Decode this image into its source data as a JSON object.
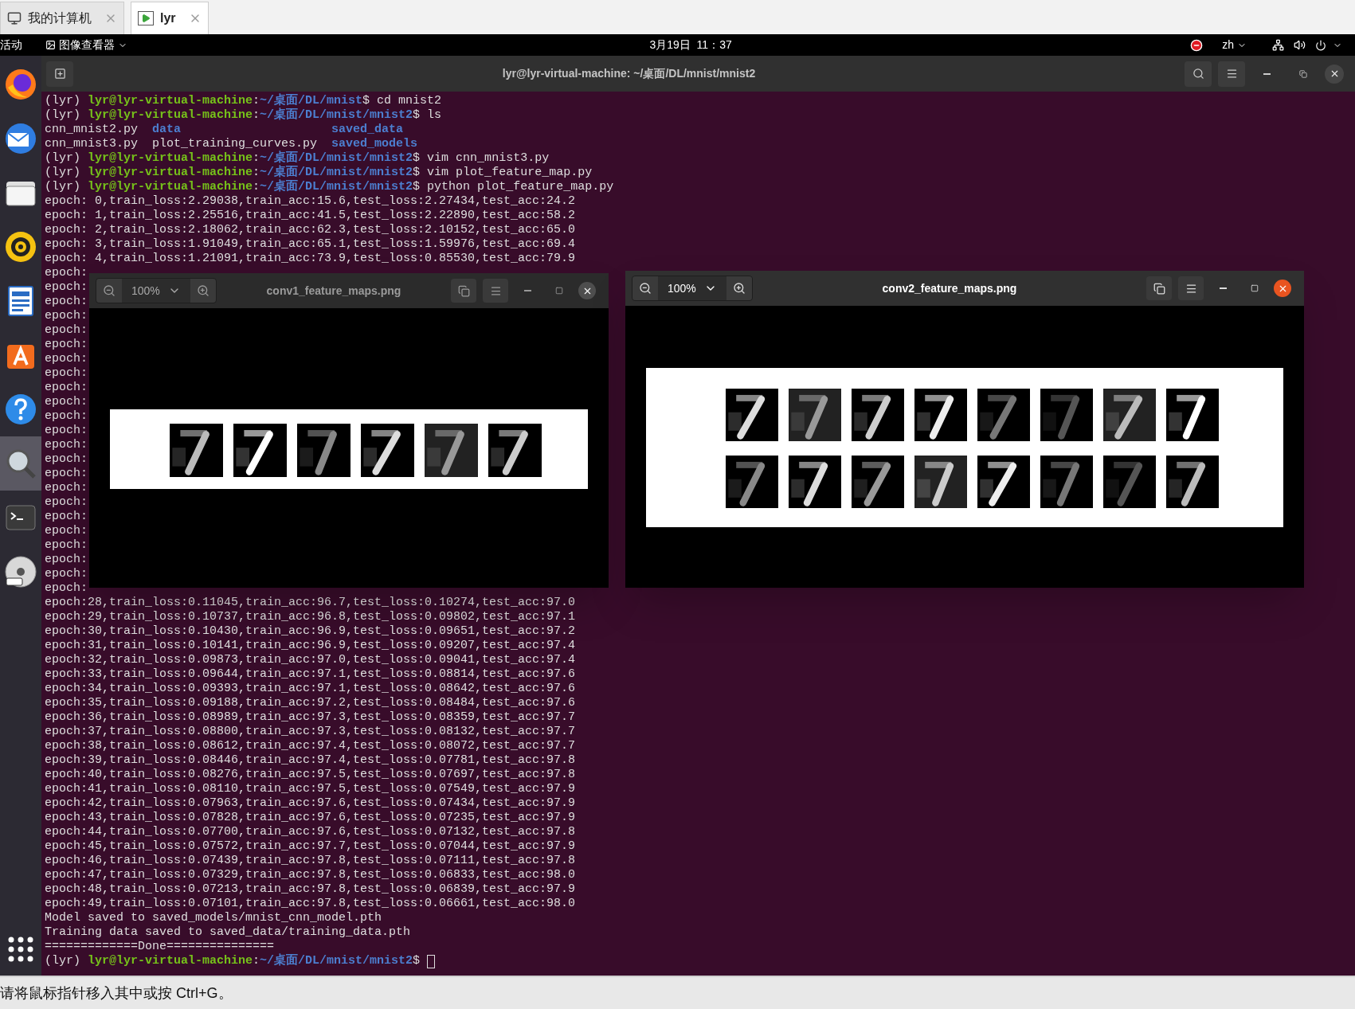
{
  "vm_tabs": [
    {
      "label": "我的计算机",
      "kind": "computer",
      "selected": false
    },
    {
      "label": "lyr",
      "kind": "vm",
      "selected": true
    }
  ],
  "top_bar": {
    "activities": "活动",
    "app_menu": "图像查看器",
    "clock": "3月19日  11：37",
    "input_method": "zh"
  },
  "dock": {
    "items": [
      {
        "kind": "browser",
        "selected": false
      },
      {
        "kind": "mail",
        "selected": false
      },
      {
        "kind": "files",
        "selected": false
      },
      {
        "kind": "music",
        "selected": false
      },
      {
        "kind": "document",
        "selected": false
      },
      {
        "kind": "software",
        "selected": false
      },
      {
        "kind": "help",
        "selected": false
      },
      {
        "kind": "viewer",
        "selected": true
      },
      {
        "kind": "terminal",
        "selected": false
      },
      {
        "kind": "disc",
        "selected": false
      }
    ]
  },
  "terminal": {
    "title": "lyr@lyr-virtual-machine: ~/桌面/DL/mnist/mnist2",
    "lines": [
      {
        "segments": [
          {
            "text": "(lyr) ",
            "kind": "plain"
          },
          {
            "text": "lyr@lyr-virtual-machine",
            "kind": "user"
          },
          {
            "text": ":",
            "kind": "plain"
          },
          {
            "text": "~/桌面/DL/mnist",
            "kind": "dir"
          },
          {
            "text": "$ cd mnist2",
            "kind": "plain"
          }
        ]
      },
      {
        "segments": [
          {
            "text": "(lyr) ",
            "kind": "plain"
          },
          {
            "text": "lyr@lyr-virtual-machine",
            "kind": "user"
          },
          {
            "text": ":",
            "kind": "plain"
          },
          {
            "text": "~/桌面/DL/mnist/mnist2",
            "kind": "dir"
          },
          {
            "text": "$ ls",
            "kind": "plain"
          }
        ]
      },
      {
        "segments": [
          {
            "text": "cnn_mnist2.py  ",
            "kind": "plain"
          },
          {
            "text": "data",
            "kind": "dir"
          },
          {
            "text": "                     saved_data",
            "kind": "dir"
          }
        ]
      },
      {
        "segments": [
          {
            "text": "cnn_mnist3.py  plot_training_curves.py  ",
            "kind": "plain"
          },
          {
            "text": "saved_models",
            "kind": "dir"
          }
        ]
      },
      {
        "segments": [
          {
            "text": "(lyr) ",
            "kind": "plain"
          },
          {
            "text": "lyr@lyr-virtual-machine",
            "kind": "user"
          },
          {
            "text": ":",
            "kind": "plain"
          },
          {
            "text": "~/桌面/DL/mnist/mnist2",
            "kind": "dir"
          },
          {
            "text": "$ vim cnn_mnist3.py",
            "kind": "plain"
          }
        ]
      },
      {
        "segments": [
          {
            "text": "(lyr) ",
            "kind": "plain"
          },
          {
            "text": "lyr@lyr-virtual-machine",
            "kind": "user"
          },
          {
            "text": ":",
            "kind": "plain"
          },
          {
            "text": "~/桌面/DL/mnist/mnist2",
            "kind": "dir"
          },
          {
            "text": "$ vim plot_feature_map.py",
            "kind": "plain"
          }
        ]
      },
      {
        "segments": [
          {
            "text": "(lyr) ",
            "kind": "plain"
          },
          {
            "text": "lyr@lyr-virtual-machine",
            "kind": "user"
          },
          {
            "text": ":",
            "kind": "plain"
          },
          {
            "text": "~/桌面/DL/mnist/mnist2",
            "kind": "dir"
          },
          {
            "text": "$ python plot_feature_map.py",
            "kind": "plain"
          }
        ]
      },
      {
        "text": "epoch: 0,train_loss:2.29038,train_acc:15.6,test_loss:2.27434,test_acc:24.2"
      },
      {
        "text": "epoch: 1,train_loss:2.25516,train_acc:41.5,test_loss:2.22890,test_acc:58.2"
      },
      {
        "text": "epoch: 2,train_loss:2.18062,train_acc:62.3,test_loss:2.10152,test_acc:65.0"
      },
      {
        "text": "epoch: 3,train_loss:1.91049,train_acc:65.1,test_loss:1.59976,test_acc:69.4"
      },
      {
        "text": "epoch: 4,train_loss:1.21091,train_acc:73.9,test_loss:0.85530,test_acc:79.9"
      },
      {
        "text": "epoch:"
      },
      {
        "text": "epoch:"
      },
      {
        "text": "epoch:"
      },
      {
        "text": "epoch:"
      },
      {
        "text": "epoch:"
      },
      {
        "text": "epoch:"
      },
      {
        "text": "epoch:"
      },
      {
        "text": "epoch:"
      },
      {
        "text": "epoch:"
      },
      {
        "text": "epoch:"
      },
      {
        "text": "epoch:"
      },
      {
        "text": "epoch:"
      },
      {
        "text": "epoch:"
      },
      {
        "text": "epoch:"
      },
      {
        "text": "epoch:"
      },
      {
        "text": "epoch:"
      },
      {
        "text": "epoch:"
      },
      {
        "text": "epoch:"
      },
      {
        "text": "epoch:"
      },
      {
        "text": "epoch:"
      },
      {
        "text": "epoch:"
      },
      {
        "text": "epoch:"
      },
      {
        "text": "epoch:"
      },
      {
        "text": "epoch:28,train_loss:0.11045,train_acc:96.7,test_loss:0.10274,test_acc:97.0"
      },
      {
        "text": "epoch:29,train_loss:0.10737,train_acc:96.8,test_loss:0.09802,test_acc:97.1"
      },
      {
        "text": "epoch:30,train_loss:0.10430,train_acc:96.9,test_loss:0.09651,test_acc:97.2"
      },
      {
        "text": "epoch:31,train_loss:0.10141,train_acc:96.9,test_loss:0.09207,test_acc:97.4"
      },
      {
        "text": "epoch:32,train_loss:0.09873,train_acc:97.0,test_loss:0.09041,test_acc:97.4"
      },
      {
        "text": "epoch:33,train_loss:0.09644,train_acc:97.1,test_loss:0.08814,test_acc:97.6"
      },
      {
        "text": "epoch:34,train_loss:0.09393,train_acc:97.1,test_loss:0.08642,test_acc:97.6"
      },
      {
        "text": "epoch:35,train_loss:0.09188,train_acc:97.2,test_loss:0.08484,test_acc:97.6"
      },
      {
        "text": "epoch:36,train_loss:0.08989,train_acc:97.3,test_loss:0.08359,test_acc:97.7"
      },
      {
        "text": "epoch:37,train_loss:0.08800,train_acc:97.3,test_loss:0.08132,test_acc:97.7"
      },
      {
        "text": "epoch:38,train_loss:0.08612,train_acc:97.4,test_loss:0.08072,test_acc:97.7"
      },
      {
        "text": "epoch:39,train_loss:0.08446,train_acc:97.4,test_loss:0.07781,test_acc:97.8"
      },
      {
        "text": "epoch:40,train_loss:0.08276,train_acc:97.5,test_loss:0.07697,test_acc:97.8"
      },
      {
        "text": "epoch:41,train_loss:0.08110,train_acc:97.5,test_loss:0.07549,test_acc:97.9"
      },
      {
        "text": "epoch:42,train_loss:0.07963,train_acc:97.6,test_loss:0.07434,test_acc:97.9"
      },
      {
        "text": "epoch:43,train_loss:0.07828,train_acc:97.6,test_loss:0.07235,test_acc:97.9"
      },
      {
        "text": "epoch:44,train_loss:0.07700,train_acc:97.6,test_loss:0.07132,test_acc:97.8"
      },
      {
        "text": "epoch:45,train_loss:0.07572,train_acc:97.7,test_loss:0.07044,test_acc:97.9"
      },
      {
        "text": "epoch:46,train_loss:0.07439,train_acc:97.8,test_loss:0.07111,test_acc:97.8"
      },
      {
        "text": "epoch:47,train_loss:0.07329,train_acc:97.8,test_loss:0.06833,test_acc:98.0"
      },
      {
        "text": "epoch:48,train_loss:0.07213,train_acc:97.8,test_loss:0.06839,test_acc:97.9"
      },
      {
        "text": "epoch:49,train_loss:0.07101,train_acc:97.8,test_loss:0.06661,test_acc:98.0"
      },
      {
        "text": "Model saved to saved_models/mnist_cnn_model.pth"
      },
      {
        "text": "Training data saved to saved_data/training_data.pth"
      },
      {
        "text": "=============Done==============="
      },
      {
        "segments": [
          {
            "text": "(lyr) ",
            "kind": "plain"
          },
          {
            "text": "lyr@lyr-virtual-machine",
            "kind": "user"
          },
          {
            "text": ":",
            "kind": "plain"
          },
          {
            "text": "~/桌面/DL/mnist/mnist2",
            "kind": "dir"
          },
          {
            "text": "$ ",
            "kind": "plain"
          }
        ],
        "cursor": true
      }
    ]
  },
  "viewers": [
    {
      "zoom": "100%",
      "title": "conv1_feature_maps.png",
      "active": false
    },
    {
      "zoom": "100%",
      "title": "conv2_feature_maps.png",
      "active": true
    }
  ],
  "status_bar": {
    "hint": "请将鼠标指针移入其中或按 Ctrl+G。"
  }
}
